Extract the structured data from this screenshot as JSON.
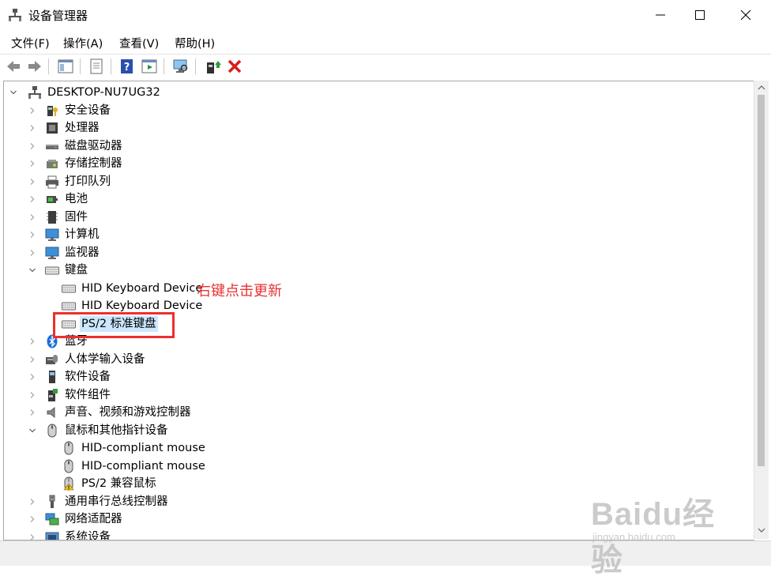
{
  "window": {
    "title": "设备管理器",
    "icon": "device-manager-icon"
  },
  "menu": {
    "items": [
      {
        "label": "文件(F)"
      },
      {
        "label": "操作(A)"
      },
      {
        "label": "查看(V)"
      },
      {
        "label": "帮助(H)"
      }
    ]
  },
  "toolbar": {
    "buttons": [
      "back-icon",
      "forward-icon",
      "show-hide-tree-icon",
      "properties-icon",
      "help-icon",
      "action-pane-icon",
      "scan-hardware-icon",
      "update-driver-icon",
      "uninstall-icon"
    ]
  },
  "tree": {
    "root": {
      "label": "DESKTOP-NU7UG32",
      "expanded": true,
      "icon": "computer-tower-icon"
    },
    "items": [
      {
        "label": "安全设备",
        "icon": "security-device-icon",
        "level": 1,
        "expander": "collapsed"
      },
      {
        "label": "处理器",
        "icon": "processor-icon",
        "level": 1,
        "expander": "collapsed"
      },
      {
        "label": "磁盘驱动器",
        "icon": "disk-drive-icon",
        "level": 1,
        "expander": "collapsed"
      },
      {
        "label": "存储控制器",
        "icon": "storage-controller-icon",
        "level": 1,
        "expander": "collapsed"
      },
      {
        "label": "打印队列",
        "icon": "printer-icon",
        "level": 1,
        "expander": "collapsed"
      },
      {
        "label": "电池",
        "icon": "battery-icon",
        "level": 1,
        "expander": "collapsed"
      },
      {
        "label": "固件",
        "icon": "firmware-icon",
        "level": 1,
        "expander": "collapsed"
      },
      {
        "label": "计算机",
        "icon": "monitor-icon",
        "level": 1,
        "expander": "collapsed"
      },
      {
        "label": "监视器",
        "icon": "monitor-icon",
        "level": 1,
        "expander": "collapsed"
      },
      {
        "label": "键盘",
        "icon": "keyboard-icon",
        "level": 1,
        "expander": "expanded"
      },
      {
        "label": "HID Keyboard Device",
        "icon": "keyboard-icon",
        "level": 2,
        "expander": "none"
      },
      {
        "label": "HID Keyboard Device",
        "icon": "keyboard-icon",
        "level": 2,
        "expander": "none"
      },
      {
        "label": "PS/2 标准键盘",
        "icon": "keyboard-icon",
        "level": 2,
        "expander": "none",
        "selected": true
      },
      {
        "label": "蓝牙",
        "icon": "bluetooth-icon",
        "level": 1,
        "expander": "collapsed"
      },
      {
        "label": "人体学输入设备",
        "icon": "hid-icon",
        "level": 1,
        "expander": "collapsed"
      },
      {
        "label": "软件设备",
        "icon": "software-device-icon",
        "level": 1,
        "expander": "collapsed"
      },
      {
        "label": "软件组件",
        "icon": "software-component-icon",
        "level": 1,
        "expander": "collapsed"
      },
      {
        "label": "声音、视频和游戏控制器",
        "icon": "speaker-icon",
        "level": 1,
        "expander": "collapsed"
      },
      {
        "label": "鼠标和其他指针设备",
        "icon": "mouse-icon",
        "level": 1,
        "expander": "expanded"
      },
      {
        "label": "HID-compliant mouse",
        "icon": "mouse-icon",
        "level": 2,
        "expander": "none"
      },
      {
        "label": "HID-compliant mouse",
        "icon": "mouse-icon",
        "level": 2,
        "expander": "none"
      },
      {
        "label": "PS/2 兼容鼠标",
        "icon": "mouse-warning-icon",
        "level": 2,
        "expander": "none"
      },
      {
        "label": "通用串行总线控制器",
        "icon": "usb-icon",
        "level": 1,
        "expander": "collapsed"
      },
      {
        "label": "网络适配器",
        "icon": "network-adapter-icon",
        "level": 1,
        "expander": "collapsed"
      },
      {
        "label": "系统设备",
        "icon": "system-device-icon",
        "level": 1,
        "expander": "collapsed"
      }
    ]
  },
  "annotation": {
    "text": "右键点击更新",
    "color": "#e8312f"
  },
  "watermark": {
    "main": "Baidu经验",
    "sub": "jingyan.baidu.com"
  },
  "colors": {
    "selection": "#cce8ff",
    "annotation_red": "#e8312f",
    "highlight_border": "#ee2e2e"
  }
}
